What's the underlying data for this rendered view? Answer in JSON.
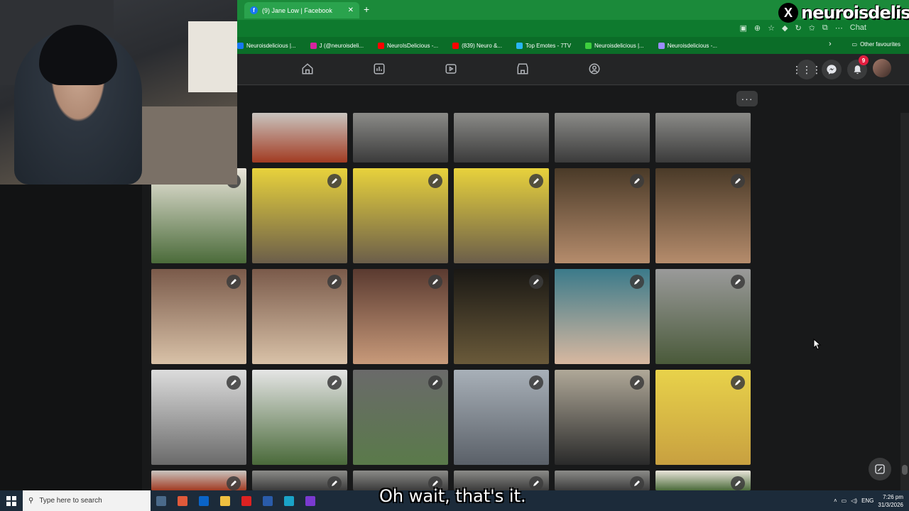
{
  "browser": {
    "tab_title": "(9) Jane Low | Facebook",
    "new_tab": "+",
    "bookmarks": [
      {
        "label": "Neuroisdelicious |...",
        "color": "#1877f2"
      },
      {
        "label": "J (@neuroisdeli...",
        "color": "#d6249f"
      },
      {
        "label": "NeuroIsDelicious -...",
        "color": "#ff0000"
      },
      {
        "label": "(839) Neuro &...",
        "color": "#ff0000"
      },
      {
        "label": "Top Emotes - 7TV",
        "color": "#29b6f6"
      },
      {
        "label": "Neuroisdelicious |...",
        "color": "#3ecf3e"
      },
      {
        "label": "Neuroisdelicious -...",
        "color": "#9b8cff"
      }
    ],
    "other_favourites": "Other favourites",
    "chat_label": "Chat"
  },
  "facebook": {
    "notification_count": "9",
    "more_label": "···",
    "nav_icons": [
      "home-icon",
      "feed-icon",
      "video-icon",
      "marketplace-icon",
      "groups-icon"
    ],
    "right_icons": [
      "menu-grid-icon",
      "messenger-icon",
      "bell-icon"
    ]
  },
  "photos": [
    {
      "top": "#c9c4bf",
      "bottom": "#a23b22"
    },
    {
      "top": "#8b8b88",
      "bottom": "#3b3b3b"
    },
    {
      "top": "#8b8b88",
      "bottom": "#3b3b3b"
    },
    {
      "top": "#8b8b88",
      "bottom": "#3b3b3b"
    },
    {
      "top": "#8b8b88",
      "bottom": "#3b3b3b"
    },
    {
      "top": "#e9e5da",
      "bottom": "#4b6b3a"
    },
    {
      "top": "#e8d23c",
      "bottom": "#6b5e4a"
    },
    {
      "top": "#e8d23c",
      "bottom": "#6b5e4a"
    },
    {
      "top": "#e8d23c",
      "bottom": "#6b5e4a"
    },
    {
      "top": "#4a3a28",
      "bottom": "#b58c6c"
    },
    {
      "top": "#4a3a28",
      "bottom": "#b58c6c"
    },
    {
      "top": "#7a5a4a",
      "bottom": "#d9c2a8"
    },
    {
      "top": "#7a5a4a",
      "bottom": "#d9c2a8"
    },
    {
      "top": "#5a3a30",
      "bottom": "#c89a7a"
    },
    {
      "top": "#1a1814",
      "bottom": "#6a5a3a"
    },
    {
      "top": "#3b7a8a",
      "bottom": "#d8b8a0"
    },
    {
      "top": "#9a9a9a",
      "bottom": "#4a5a3a"
    },
    {
      "top": "#dcdcdc",
      "bottom": "#6a6a6a"
    },
    {
      "top": "#e5e5e5",
      "bottom": "#4a6a3a"
    },
    {
      "top": "#6a6a6a",
      "bottom": "#5a7a4a"
    },
    {
      "top": "#a8b0b8",
      "bottom": "#5a6068"
    },
    {
      "top": "#b0a898",
      "bottom": "#2a2a2a"
    },
    {
      "top": "#e8d24a",
      "bottom": "#c8a040"
    }
  ],
  "watermark": {
    "x": "X",
    "name": "neuroisdelish"
  },
  "caption": "Oh wait, that's it.",
  "taskbar": {
    "search_placeholder": "Type here to search",
    "language": "ENG",
    "time": "7:26 pm",
    "date": "31/3/2026"
  }
}
